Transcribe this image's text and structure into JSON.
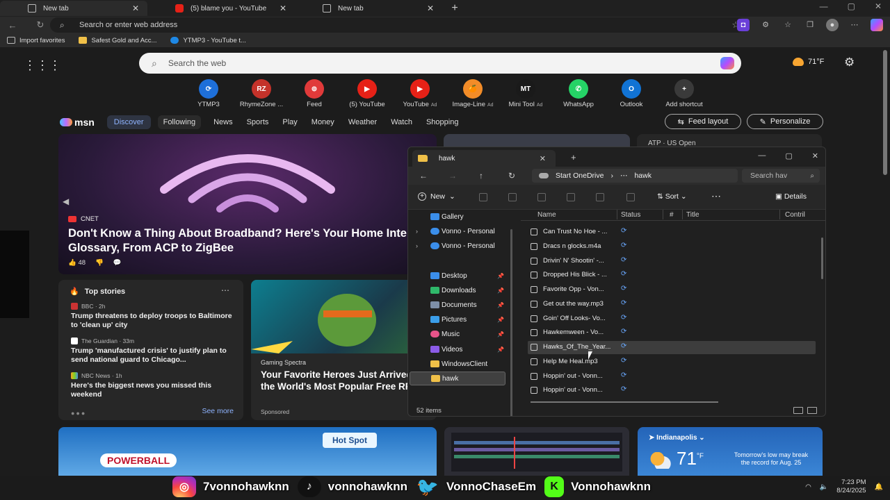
{
  "browser": {
    "tabs": [
      {
        "title": "New tab",
        "icon": "newtab-icon"
      },
      {
        "title": "(5) blame you - YouTube",
        "icon": "youtube-icon"
      },
      {
        "title": "New tab",
        "icon": "newtab-icon"
      }
    ],
    "address_placeholder": "Search or enter web address",
    "favorites": [
      {
        "label": "Import favorites"
      },
      {
        "label": "Safest Gold and Acc..."
      },
      {
        "label": "YTMP3 - YouTube t..."
      }
    ]
  },
  "msn": {
    "search_placeholder": "Search the web",
    "weather_temp": "71°F",
    "shortcuts": [
      {
        "label": "YTMP3",
        "ad": "",
        "color": "#1e6fd9",
        "glyph": "⟳"
      },
      {
        "label": "RhymeZone ...",
        "ad": "",
        "color": "#c4322a",
        "glyph": "RZ"
      },
      {
        "label": "Feed",
        "ad": "",
        "color": "#e03a3a",
        "glyph": "⊚"
      },
      {
        "label": "(5) YouTube",
        "ad": "",
        "color": "#e62117",
        "glyph": "▶"
      },
      {
        "label": "YouTube",
        "ad": "Ad",
        "color": "#e62117",
        "glyph": "▶"
      },
      {
        "label": "Image-Line",
        "ad": "Ad",
        "color": "#f28c28",
        "glyph": "🍊"
      },
      {
        "label": "Mini Tool",
        "ad": "Ad",
        "color": "#1a1a1a",
        "glyph": "MT"
      },
      {
        "label": "WhatsApp",
        "ad": "",
        "color": "#25d366",
        "glyph": "✆"
      },
      {
        "label": "Outlook",
        "ad": "",
        "color": "#1173d4",
        "glyph": "O"
      },
      {
        "label": "Add shortcut",
        "ad": "",
        "color": "#3a3a3a",
        "glyph": "+"
      }
    ],
    "logo": "msn",
    "nav": [
      "Discover",
      "Following",
      "News",
      "Sports",
      "Play",
      "Money",
      "Weather",
      "Watch",
      "Shopping"
    ],
    "feed_layout": "Feed layout",
    "personalize": "Personalize",
    "hero": {
      "source": "CNET",
      "title": "Don't Know a Thing About Broadband? Here's Your Home Internet Glossary, From ACP to ZigBee",
      "likes": "48"
    },
    "top_stories": {
      "heading": "Top stories",
      "stories": [
        {
          "source": "BBC · 2h",
          "title": "Trump threatens to deploy troops to Baltimore to 'clean up' city"
        },
        {
          "source": "The Guardian · 33m",
          "title": "Trump 'manufactured crisis' to justify plan to send national guard to Chicago..."
        },
        {
          "source": "NBC News · 1h",
          "title": "Here's the biggest news you missed this weekend"
        }
      ],
      "see_more": "See more"
    },
    "game_card": {
      "source": "Gaming Spectra",
      "title": "Your Favorite Heroes Just Arrived in the World's Most Popular Free RPG",
      "sponsored": "Sponsored"
    },
    "atp_card": "ATP · US Open",
    "lottery": {
      "brand": "POWERBALL",
      "hotspot": "Hot Spot"
    },
    "weather_card": {
      "city": "Indianapolis",
      "temp": "71",
      "unit": "°F",
      "note": "Tomorrow's low may break the record for Aug. 25"
    }
  },
  "explorer": {
    "tab_title": "hawk",
    "breadcrumb": [
      "Start OneDrive",
      "hawk"
    ],
    "search_placeholder": "Search hav",
    "commands": {
      "new": "New",
      "sort": "Sort",
      "details": "Details"
    },
    "sidebar": [
      {
        "label": "Gallery",
        "color": "#3b8eea",
        "chev": "",
        "pin": false
      },
      {
        "label": "Vonno - Personal",
        "color": "#3b8eea",
        "chev": "›",
        "pin": false
      },
      {
        "label": "Vonno - Personal",
        "color": "#3b8eea",
        "chev": "›",
        "pin": false
      },
      {
        "label": "Desktop",
        "color": "#3b8eea",
        "chev": "",
        "pin": true
      },
      {
        "label": "Downloads",
        "color": "#2fb86a",
        "chev": "",
        "pin": true
      },
      {
        "label": "Documents",
        "color": "#7d8fa8",
        "chev": "",
        "pin": true
      },
      {
        "label": "Pictures",
        "color": "#3b9eea",
        "chev": "",
        "pin": true
      },
      {
        "label": "Music",
        "color": "#e8548a",
        "chev": "",
        "pin": true
      },
      {
        "label": "Videos",
        "color": "#8b5be8",
        "chev": "",
        "pin": true
      },
      {
        "label": "WindowsClient",
        "color": "#f0c048",
        "chev": "",
        "pin": false
      },
      {
        "label": "hawk",
        "color": "#f0c048",
        "chev": "",
        "pin": false
      }
    ],
    "columns": [
      "Name",
      "Status",
      "#",
      "Title",
      "Contril"
    ],
    "files": [
      "Can Trust No Hoe - ...",
      "Dracs n glocks.m4a",
      "Drivin' N' Shootin' -...",
      "Dropped His Blick - ...",
      "Favorite Opp - Von...",
      "Get out the way.mp3",
      "Goin' Off Looks- Vo...",
      "Hawkemween - Vo...",
      "Hawks_Of_The_Year...",
      "Help Me Heal.mp3",
      "Hoppin' out - Vonn...",
      "Hoppin' out - Vonn..."
    ],
    "status_glyph": "⟳",
    "item_count": "52 items"
  },
  "taskbar": {
    "time": "7:23 PM",
    "date": "8/24/2025"
  },
  "overlay": [
    {
      "handle": "7vonnohawknn",
      "icon": "instagram-icon"
    },
    {
      "handle": "vonnohawknn",
      "icon": "tiktok-icon"
    },
    {
      "handle": "VonnoChaseEm",
      "icon": "twitter-icon"
    },
    {
      "handle": "Vonnohawknn",
      "icon": "kick-icon"
    }
  ]
}
